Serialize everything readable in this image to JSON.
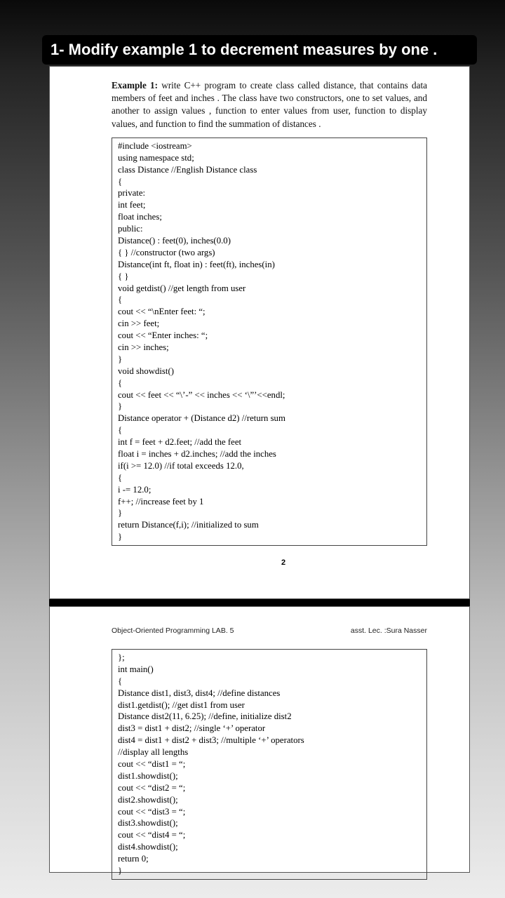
{
  "title": "1- Modify example 1 to decrement measures by one .",
  "prompt_bold": "Example 1:",
  "prompt_text": " write C++ program to create class called distance, that contains data members of feet and inches . The class have two constructors, one to set values, and another to assign values , function to enter values from user, function to display values, and function to find the summation of distances .",
  "code1": "#include <iostream>\nusing namespace std;\nclass Distance //English Distance class\n{\nprivate:\nint feet;\nfloat inches;\npublic:\nDistance() : feet(0), inches(0.0)\n{ } //constructor (two args)\nDistance(int ft, float in) : feet(ft), inches(in)\n{ }\nvoid getdist() //get length from user\n{\ncout << “\\nEnter feet: “;\ncin >> feet;\ncout << “Enter inches: “;\ncin >> inches;\n}\nvoid showdist()\n{\ncout << feet << “\\’-” << inches << ‘\\”’<<endl;\n}\nDistance operator + (Distance d2) //return sum\n{\nint f = feet + d2.feet; //add the feet\nfloat i = inches + d2.inches; //add the inches\nif(i >= 12.0) //if total exceeds 12.0,\n{\ni -= 12.0;\nf++; //increase feet by 1\n}\nreturn Distance(f,i); //initialized to sum\n}",
  "page_number": "2",
  "header_left": "Object-Oriented Programming LAB. 5",
  "header_right": "asst. Lec. :Sura Nasser",
  "code2": "};\nint main()\n{\nDistance dist1, dist3, dist4; //define distances\ndist1.getdist(); //get dist1 from user\nDistance dist2(11, 6.25); //define, initialize dist2\ndist3 = dist1 + dist2; //single ‘+’ operator\ndist4 = dist1 + dist2 + dist3; //multiple ‘+’ operators\n//display all lengths\ncout << “dist1 = “;\ndist1.showdist();\ncout << “dist2 = “;\ndist2.showdist();\ncout << “dist3 = “;\ndist3.showdist();\ncout << “dist4 = “;\ndist4.showdist();\nreturn 0;\n}"
}
